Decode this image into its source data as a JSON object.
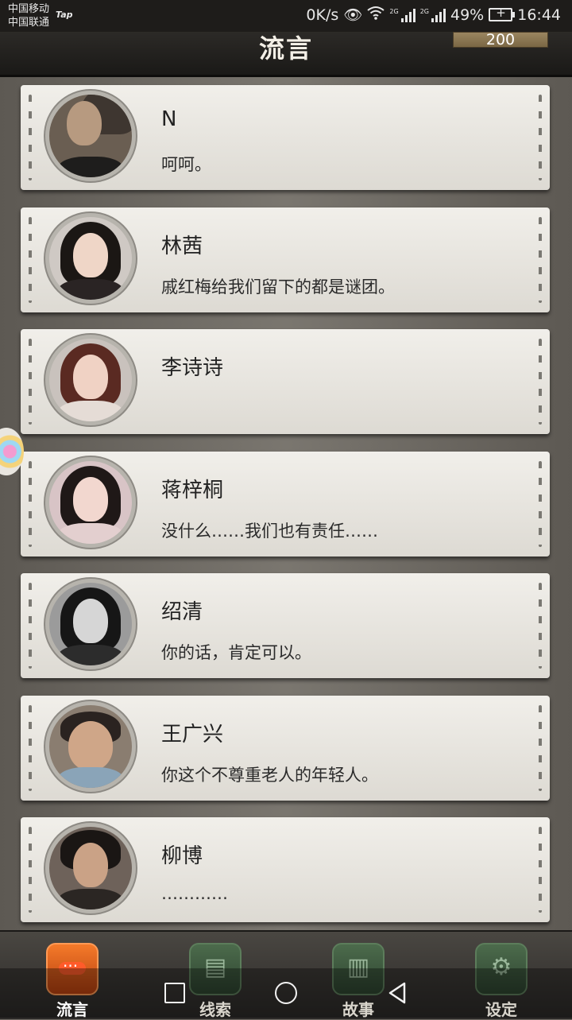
{
  "status_bar": {
    "carrier1": "中国移动",
    "carrier2": "中国联通",
    "tap_badge": "Tap",
    "net_speed": "0K/s",
    "signal1_tag": "2G",
    "signal2_tag": "2G",
    "battery": "49%",
    "time": "16:44"
  },
  "header": {
    "title": "流言",
    "coins": "200"
  },
  "contacts": [
    {
      "name": "N",
      "message": "呵呵。"
    },
    {
      "name": "林茜",
      "message": "戚红梅给我们留下的都是谜团。"
    },
    {
      "name": "李诗诗",
      "message": ""
    },
    {
      "name": "蒋梓桐",
      "message": "没什么……我们也有责任……"
    },
    {
      "name": "绍清",
      "message": "你的话，肯定可以。"
    },
    {
      "name": "王广兴",
      "message": "你这个不尊重老人的年轻人。"
    },
    {
      "name": "柳博",
      "message": "…………"
    }
  ],
  "tabs": [
    {
      "label": "流言",
      "icon": "chat-bubble-icon",
      "active": true
    },
    {
      "label": "线索",
      "icon": "notes-icon",
      "active": false
    },
    {
      "label": "故事",
      "icon": "book-icon",
      "active": false
    },
    {
      "label": "设定",
      "icon": "gear-icon",
      "active": false
    }
  ],
  "colors": {
    "active_tab": "#e8601c",
    "inactive_tab": "#3d5a3e",
    "card": "#e9e7e2"
  }
}
